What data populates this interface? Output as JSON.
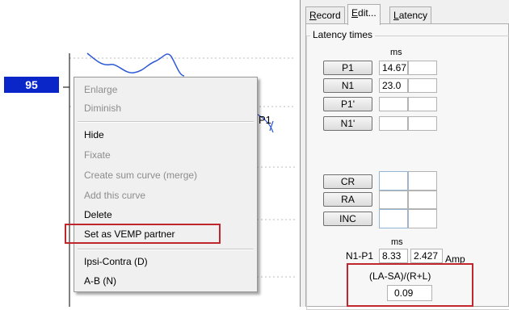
{
  "level_badge": "95",
  "peak_marker": "P1",
  "context_menu": {
    "items": [
      {
        "label": "Enlarge",
        "enabled": false
      },
      {
        "label": "Diminish",
        "enabled": false
      },
      {
        "label": "Hide",
        "enabled": true
      },
      {
        "label": "Fixate",
        "enabled": false
      },
      {
        "label": "Create sum curve (merge)",
        "enabled": false
      },
      {
        "label": "Add this curve",
        "enabled": false
      },
      {
        "label": "Delete",
        "enabled": true
      },
      {
        "label": "Set as VEMP partner",
        "enabled": true,
        "highlighted": true
      },
      {
        "label": "Ipsi-Contra (D)",
        "enabled": true
      },
      {
        "label": "A-B (N)",
        "enabled": true
      }
    ]
  },
  "panel": {
    "tabs": [
      {
        "label": "Record",
        "mnemonic": "R",
        "rest": "ecord",
        "active": false
      },
      {
        "label": "Edit...",
        "mnemonic": "E",
        "rest": "dit...",
        "active": true
      },
      {
        "label": "Latency",
        "mnemonic": "L",
        "rest": "atency",
        "active": false
      }
    ],
    "group_title": "Latency times",
    "ms_header": "ms",
    "latency_rows": [
      {
        "button": "P1",
        "value": "14.67",
        "extra": ""
      },
      {
        "button": "N1",
        "value": "23.0",
        "extra": ""
      },
      {
        "button": "P1'",
        "value": "",
        "extra": ""
      },
      {
        "button": "N1'",
        "value": "",
        "extra": ""
      }
    ],
    "marker_rows": [
      {
        "button": "CR",
        "value": "",
        "extra": ""
      },
      {
        "button": "RA",
        "value": "",
        "extra": ""
      },
      {
        "button": "INC",
        "value": "",
        "extra": ""
      }
    ],
    "amplitude": {
      "ms_header": "ms",
      "label": "N1-P1",
      "latency_value": "8.33",
      "amp_value": "2.427",
      "amp_label": "Amp"
    },
    "ratio": {
      "label": "(LA-SA)/(R+L)",
      "value": "0.09"
    }
  },
  "colors": {
    "badge": "#0a26c8",
    "highlight": "#c0272d",
    "waveform": "#2c58d6"
  }
}
